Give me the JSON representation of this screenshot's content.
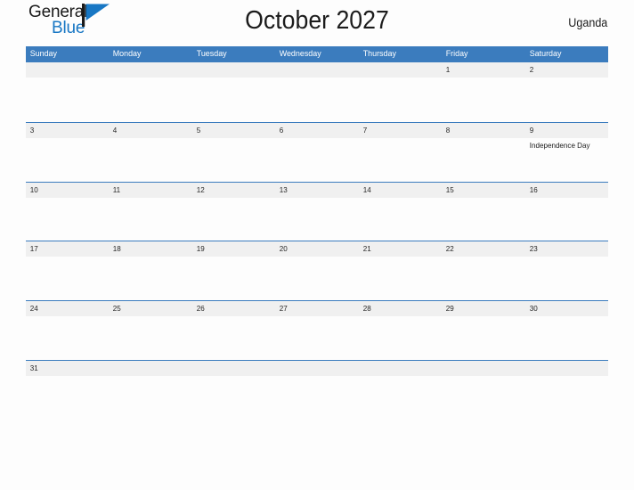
{
  "brand": {
    "name_part1": "General",
    "name_part2": "Blue",
    "flag_icon": "flag-icon",
    "primary_color": "#1877c4"
  },
  "header": {
    "title": "October 2027",
    "country": "Uganda"
  },
  "calendar": {
    "header_color": "#3b7cbe",
    "band_color": "#f0f0f0",
    "weekdays": [
      "Sunday",
      "Monday",
      "Tuesday",
      "Wednesday",
      "Thursday",
      "Friday",
      "Saturday"
    ],
    "weeks": [
      {
        "days": [
          {
            "num": "",
            "event": ""
          },
          {
            "num": "",
            "event": ""
          },
          {
            "num": "",
            "event": ""
          },
          {
            "num": "",
            "event": ""
          },
          {
            "num": "",
            "event": ""
          },
          {
            "num": "1",
            "event": ""
          },
          {
            "num": "2",
            "event": ""
          }
        ]
      },
      {
        "days": [
          {
            "num": "3",
            "event": ""
          },
          {
            "num": "4",
            "event": ""
          },
          {
            "num": "5",
            "event": ""
          },
          {
            "num": "6",
            "event": ""
          },
          {
            "num": "7",
            "event": ""
          },
          {
            "num": "8",
            "event": ""
          },
          {
            "num": "9",
            "event": "Independence Day"
          }
        ]
      },
      {
        "days": [
          {
            "num": "10",
            "event": ""
          },
          {
            "num": "11",
            "event": ""
          },
          {
            "num": "12",
            "event": ""
          },
          {
            "num": "13",
            "event": ""
          },
          {
            "num": "14",
            "event": ""
          },
          {
            "num": "15",
            "event": ""
          },
          {
            "num": "16",
            "event": ""
          }
        ]
      },
      {
        "days": [
          {
            "num": "17",
            "event": ""
          },
          {
            "num": "18",
            "event": ""
          },
          {
            "num": "19",
            "event": ""
          },
          {
            "num": "20",
            "event": ""
          },
          {
            "num": "21",
            "event": ""
          },
          {
            "num": "22",
            "event": ""
          },
          {
            "num": "23",
            "event": ""
          }
        ]
      },
      {
        "days": [
          {
            "num": "24",
            "event": ""
          },
          {
            "num": "25",
            "event": ""
          },
          {
            "num": "26",
            "event": ""
          },
          {
            "num": "27",
            "event": ""
          },
          {
            "num": "28",
            "event": ""
          },
          {
            "num": "29",
            "event": ""
          },
          {
            "num": "30",
            "event": ""
          }
        ]
      },
      {
        "days": [
          {
            "num": "31",
            "event": ""
          },
          {
            "num": "",
            "event": ""
          },
          {
            "num": "",
            "event": ""
          },
          {
            "num": "",
            "event": ""
          },
          {
            "num": "",
            "event": ""
          },
          {
            "num": "",
            "event": ""
          },
          {
            "num": "",
            "event": ""
          }
        ]
      }
    ]
  }
}
